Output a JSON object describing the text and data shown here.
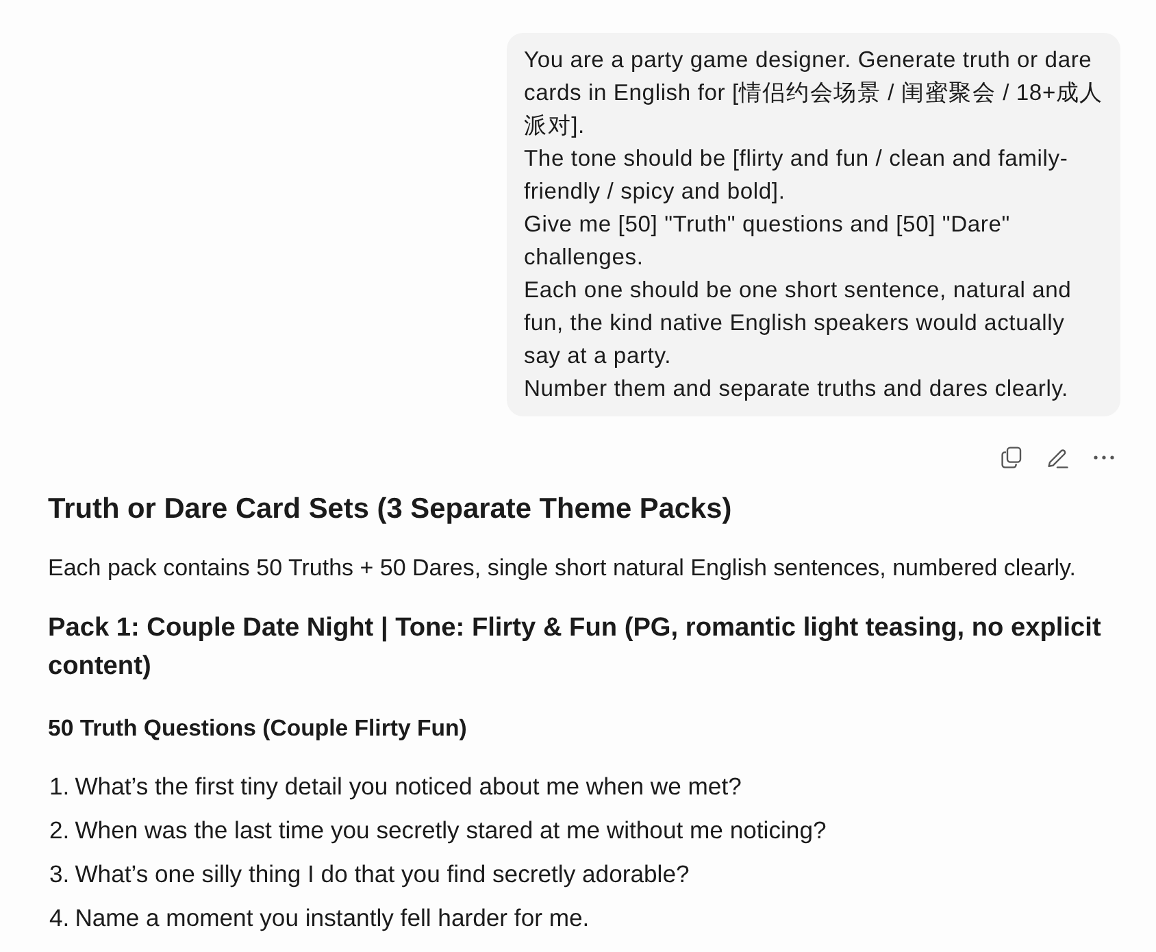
{
  "user_message": {
    "paragraphs": [
      "You are a party game designer. Generate truth or dare cards in English for [情侣约会场景 / 闺蜜聚会 / 18+成人派对].",
      "The tone should be [flirty and fun / clean and family-friendly / spicy and bold].",
      "Give me [50] \"Truth\" questions and [50] \"Dare\" challenges.",
      "Each one should be one short sentence, natural and fun, the kind native English speakers would actually say at a party.",
      "Number them and separate truths and dares clearly."
    ]
  },
  "response": {
    "title": "Truth or Dare Card Sets (3 Separate Theme Packs)",
    "intro": "Each pack contains 50 Truths + 50 Dares, single short natural English sentences, numbered clearly.",
    "sections": [
      {
        "heading": "Pack 1: Couple Date Night | Tone: Flirty & Fun (PG, romantic light teasing, no explicit content)",
        "subheading": "50 Truth Questions (Couple Flirty Fun)",
        "items": [
          {
            "number": "1.",
            "text": "What’s the first tiny detail you noticed about me when we met?"
          },
          {
            "number": "2.",
            "text": "When was the last time you secretly stared at me without me noticing?"
          },
          {
            "number": "3.",
            "text": "What’s one silly thing I do that you find secretly adorable?"
          },
          {
            "number": "4.",
            "text": "Name a moment you instantly fell harder for me."
          }
        ]
      }
    ]
  }
}
